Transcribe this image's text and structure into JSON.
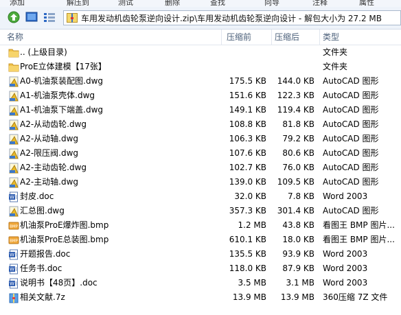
{
  "toolbar": {
    "items": [
      "添加",
      "解压到",
      "测试",
      "删除",
      "查找",
      "向导",
      "注释",
      "属性"
    ]
  },
  "address": {
    "path": "车用发动机齿轮泵逆向设计.zip\\车用发动机齿轮泵逆向设计 - 解包大小为 27.2 MB"
  },
  "columns": {
    "name": "名称",
    "size": "压缩前",
    "packed": "压缩后",
    "type": "类型"
  },
  "files": [
    {
      "name": ".. (上级目录)",
      "size": "",
      "packed": "",
      "type": "文件夹",
      "icon": "folder-icon"
    },
    {
      "name": "ProE立体建模【17张】",
      "size": "",
      "packed": "",
      "type": "文件夹",
      "icon": "folder-icon"
    },
    {
      "name": "A0-机油泵装配图.dwg",
      "size": "175.5 KB",
      "packed": "144.0 KB",
      "type": "AutoCAD 图形",
      "icon": "dwg-icon"
    },
    {
      "name": "A1-机油泵壳体.dwg",
      "size": "151.6 KB",
      "packed": "122.3 KB",
      "type": "AutoCAD 图形",
      "icon": "dwg-icon"
    },
    {
      "name": "A1-机油泵下端盖.dwg",
      "size": "149.1 KB",
      "packed": "119.4 KB",
      "type": "AutoCAD 图形",
      "icon": "dwg-icon"
    },
    {
      "name": "A2-从动齿轮.dwg",
      "size": "108.8 KB",
      "packed": "81.8 KB",
      "type": "AutoCAD 图形",
      "icon": "dwg-icon"
    },
    {
      "name": "A2-从动轴.dwg",
      "size": "106.3 KB",
      "packed": "79.2 KB",
      "type": "AutoCAD 图形",
      "icon": "dwg-icon"
    },
    {
      "name": "A2-限压阀.dwg",
      "size": "107.6 KB",
      "packed": "80.6 KB",
      "type": "AutoCAD 图形",
      "icon": "dwg-icon"
    },
    {
      "name": "A2-主动齿轮.dwg",
      "size": "102.7 KB",
      "packed": "76.0 KB",
      "type": "AutoCAD 图形",
      "icon": "dwg-icon"
    },
    {
      "name": "A2-主动轴.dwg",
      "size": "139.0 KB",
      "packed": "109.5 KB",
      "type": "AutoCAD 图形",
      "icon": "dwg-icon"
    },
    {
      "name": "封皮.doc",
      "size": "32.0 KB",
      "packed": "7.8 KB",
      "type": "Word 2003",
      "icon": "doc-icon"
    },
    {
      "name": "汇总图.dwg",
      "size": "357.3 KB",
      "packed": "301.4 KB",
      "type": "AutoCAD 图形",
      "icon": "dwg-icon"
    },
    {
      "name": "机油泵ProE爆炸图.bmp",
      "size": "1.2 MB",
      "packed": "43.8 KB",
      "type": "看图王 BMP 图片...",
      "icon": "bmp-icon"
    },
    {
      "name": "机油泵ProE总装图.bmp",
      "size": "610.1 KB",
      "packed": "18.0 KB",
      "type": "看图王 BMP 图片...",
      "icon": "bmp-icon"
    },
    {
      "name": "开题报告.doc",
      "size": "135.5 KB",
      "packed": "93.9 KB",
      "type": "Word 2003",
      "icon": "doc-icon"
    },
    {
      "name": "任务书.doc",
      "size": "118.0 KB",
      "packed": "87.9 KB",
      "type": "Word 2003",
      "icon": "doc-icon"
    },
    {
      "name": "说明书【48页】.doc",
      "size": "3.5 MB",
      "packed": "3.1 MB",
      "type": "Word 2003",
      "icon": "doc-icon"
    },
    {
      "name": "相关文献.7z",
      "size": "13.9 MB",
      "packed": "13.9 MB",
      "type": "360压缩 7Z 文件",
      "icon": "archive-icon"
    }
  ]
}
